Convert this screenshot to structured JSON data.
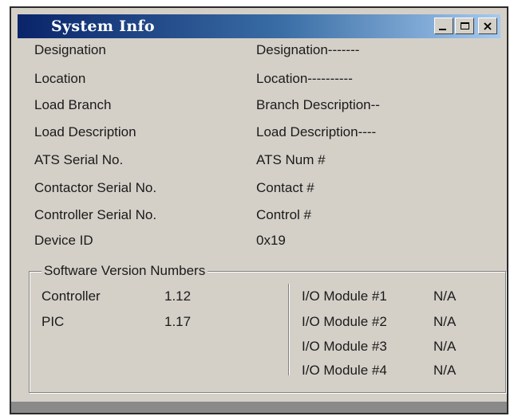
{
  "window": {
    "title": "System Info"
  },
  "title_buttons": {
    "minimize_icon": "minimize-icon",
    "maximize_icon": "maximize-icon",
    "close_icon": "close-icon",
    "close_glyph": "×"
  },
  "fields": [
    {
      "label": "Designation",
      "value": "Designation-------"
    },
    {
      "label": "Location",
      "value": "Location----------"
    },
    {
      "label": "Load Branch",
      "value": "Branch Description--"
    },
    {
      "label": "Load Description",
      "value": "Load Description----"
    },
    {
      "label": "ATS Serial No.",
      "value": "ATS Num #"
    },
    {
      "label": "Contactor Serial No.",
      "value": "Contact #"
    },
    {
      "label": "Controller Serial No.",
      "value": "Control #"
    },
    {
      "label": "Device ID",
      "value": "0x19"
    }
  ],
  "software": {
    "legend": "Software Version Numbers",
    "left": [
      {
        "label": "Controller",
        "value": "1.12"
      },
      {
        "label": "PIC",
        "value": "1.17"
      }
    ],
    "right": [
      {
        "label": "I/O Module #1",
        "value": "N/A"
      },
      {
        "label": "I/O Module #2",
        "value": "N/A"
      },
      {
        "label": "I/O Module #3",
        "value": "N/A"
      },
      {
        "label": "I/O Module #4",
        "value": "N/A"
      }
    ]
  }
}
